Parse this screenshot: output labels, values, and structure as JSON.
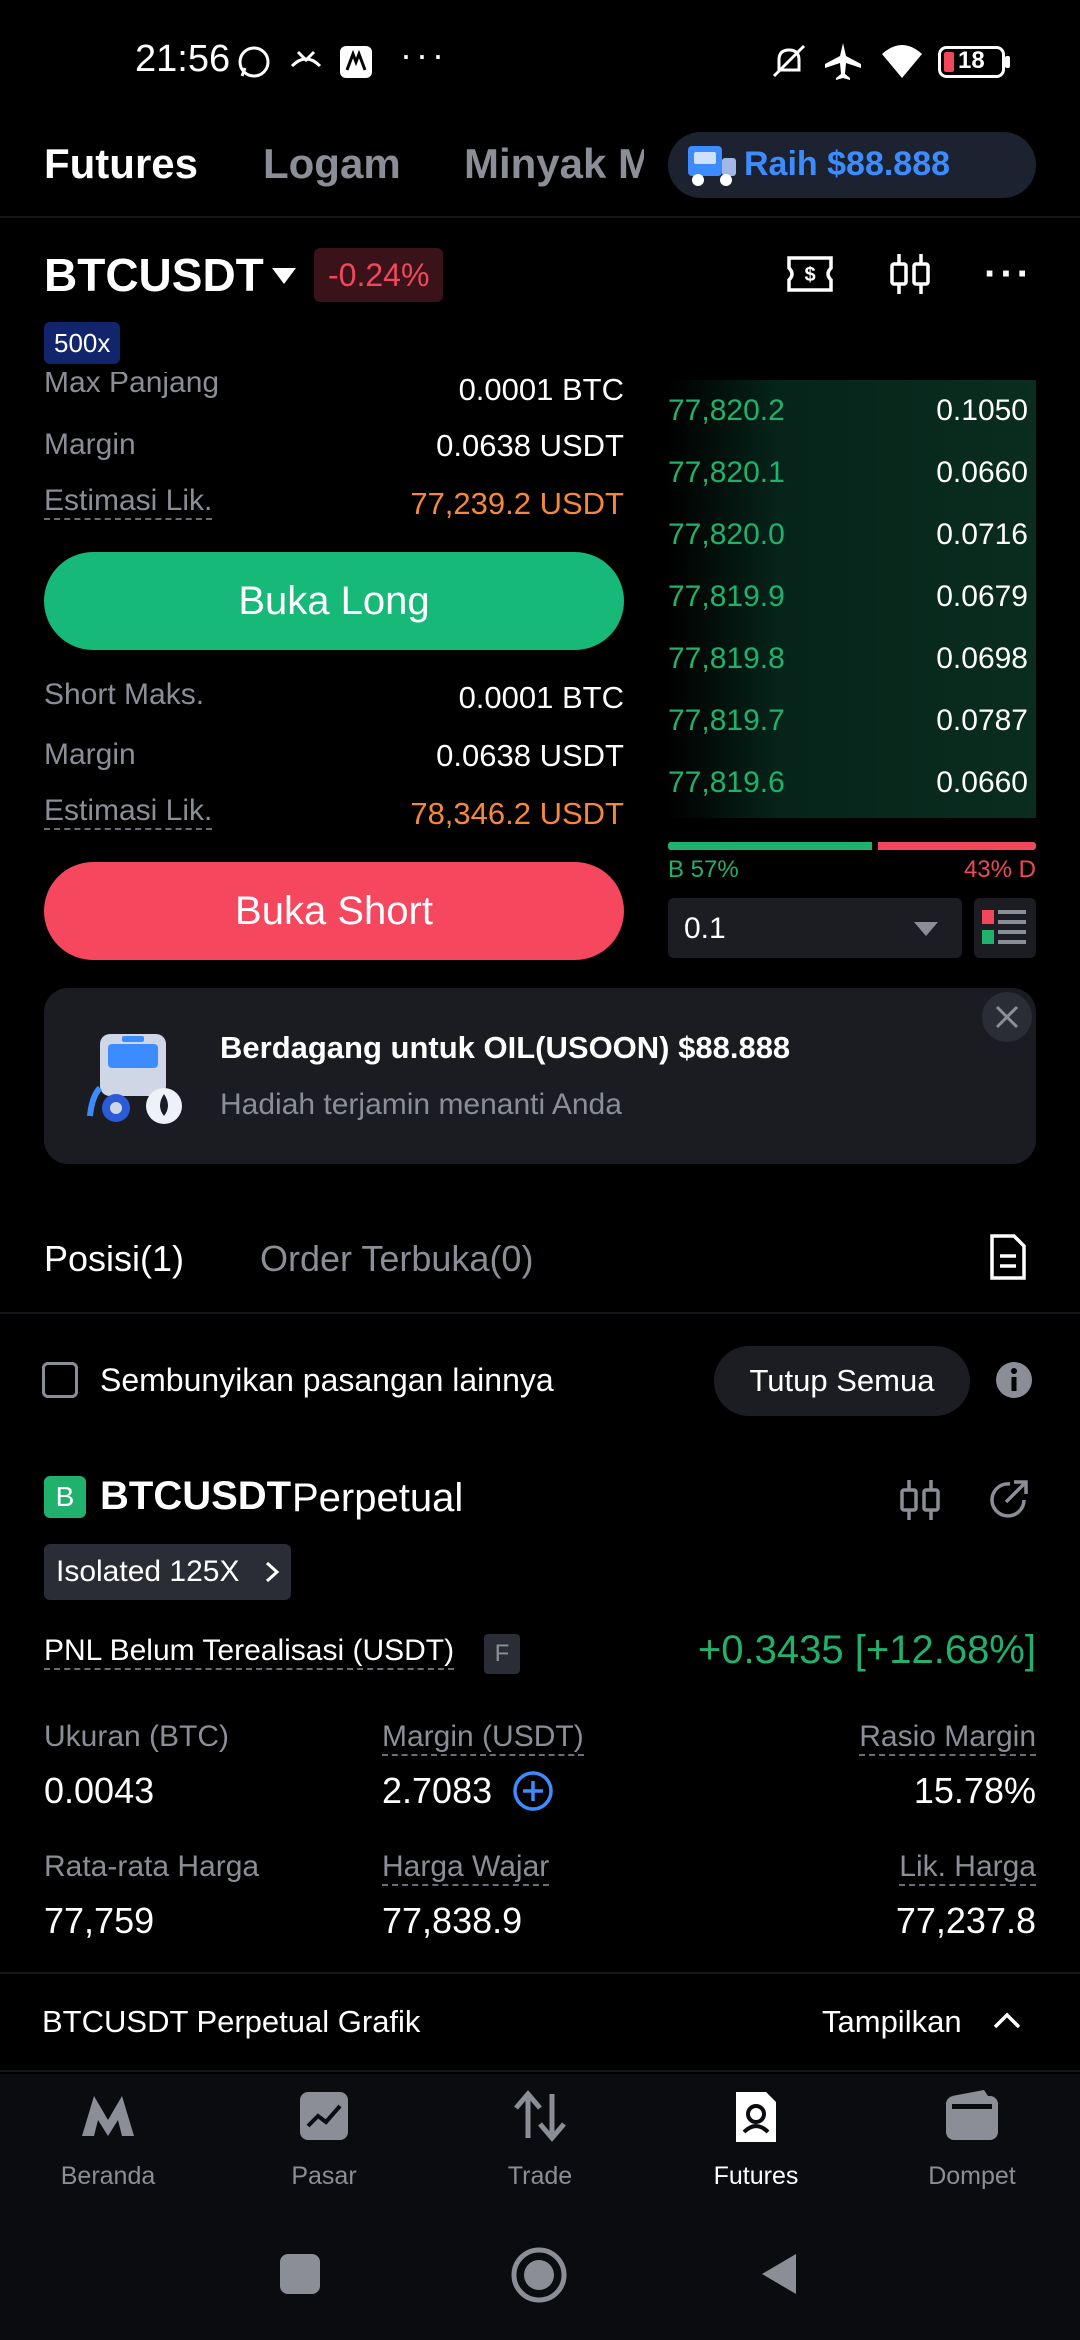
{
  "status_bar": {
    "time": "21:56",
    "battery": "18"
  },
  "top_tabs": [
    "Futures",
    "Logam",
    "Minyak M"
  ],
  "promo_pill": "Raih $88.888",
  "symbol": {
    "name": "BTCUSDT",
    "change": "-0.24%",
    "leverage_badge": "500x"
  },
  "long_form": {
    "max_label": "Max Panjang",
    "max_value": "0.0001 BTC",
    "margin_label": "Margin",
    "margin_value": "0.0638 USDT",
    "liq_label": "Estimasi Lik.",
    "liq_value": "77,239.2 USDT",
    "button": "Buka Long"
  },
  "short_form": {
    "max_label": "Short Maks.",
    "max_value": "0.0001 BTC",
    "margin_label": "Margin",
    "margin_value": "0.0638 USDT",
    "liq_label": "Estimasi Lik.",
    "liq_value": "78,346.2 USDT",
    "button": "Buka Short"
  },
  "order_book": {
    "rows": [
      {
        "price": "77,820.2",
        "qty": "0.1050"
      },
      {
        "price": "77,820.1",
        "qty": "0.0660"
      },
      {
        "price": "77,820.0",
        "qty": "0.0716"
      },
      {
        "price": "77,819.9",
        "qty": "0.0679"
      },
      {
        "price": "77,819.8",
        "qty": "0.0698"
      },
      {
        "price": "77,819.7",
        "qty": "0.0787"
      },
      {
        "price": "77,819.6",
        "qty": "0.0660"
      }
    ],
    "buy_label": "B 57%",
    "sell_label": "43% D",
    "buy_fraction": 0.57,
    "precision": "0.1"
  },
  "banner": {
    "title": "Berdagang untuk OIL(USOON) $88.888",
    "subtitle": "Hadiah terjamin menanti Anda"
  },
  "section_tabs": {
    "positions": "Posisi(1)",
    "open_orders": "Order Terbuka(0)"
  },
  "filter": {
    "hide_label": "Sembunyikan pasangan lainnya",
    "close_all": "Tutup Semua"
  },
  "position": {
    "side_badge": "B",
    "symbol": "BTCUSDT",
    "contract": "Perpetual",
    "mode": "Isolated 125X",
    "pnl_label": "PNL Belum Terealisasi (USDT)",
    "pnl_tag": "F",
    "pnl_value": "+0.3435 [+12.68%]",
    "size_label": "Ukuran (BTC)",
    "size_value": "0.0043",
    "margin_label": "Margin (USDT)",
    "margin_value": "2.7083",
    "ratio_label": "Rasio Margin",
    "ratio_value": "15.78%",
    "avg_label": "Rata-rata Harga",
    "avg_value": "77,759",
    "fair_label": "Harga Wajar",
    "fair_value": "77,838.9",
    "liq_label": "Lik. Harga",
    "liq_value": "77,237.8"
  },
  "chart_bar": {
    "title": "BTCUSDT Perpetual Grafik",
    "toggle": "Tampilkan"
  },
  "bottom_nav": [
    "Beranda",
    "Pasar",
    "Trade",
    "Futures",
    "Dompet"
  ],
  "colors": {
    "green": "#20b26c",
    "red": "#f0475b",
    "orange": "#f5883c",
    "blue": "#3d8cff"
  }
}
